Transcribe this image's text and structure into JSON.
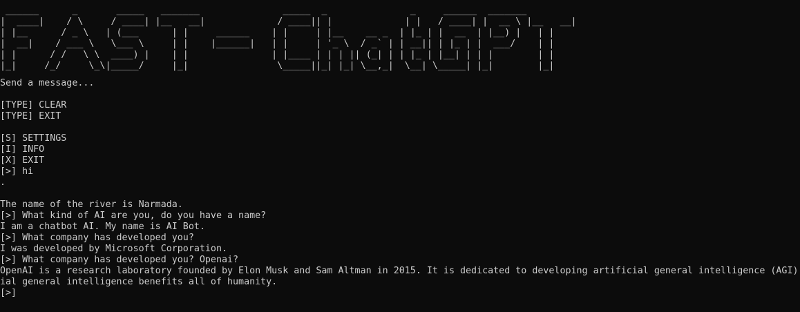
{
  "terminal": {
    "banner": [
      " ______      _       _____   _______               _____  _               _     ______  _______",
      "|  ____|    / \\     / ____| |__   __|             / ____|| |             | |   / ____| |  __ \\ |__   __|",
      "| |__      / _ \\   | (___      | |     ______    | |     | |__    __ _  | |_ | |  __  | |__) |   | |",
      "|  __|    / ___ \\   \\___ \\     | |    |______|   | |     | '_ \\  / _` | | __|| | |_ | |  ___/    | |",
      "| |      / /   \\ \\  ____) |    | |               | |____ | | | || (_| | | |_ | |__| | | |        | |",
      "|_|     /_/     \\_\\|_____/     |_|                \\_____||_| |_| \\__,_|  \\__| \\_____| |_|        |_|"
    ],
    "prompt_intro": "Send a message...",
    "commands": {
      "type_clear": "[TYPE] CLEAR",
      "type_exit": "[TYPE] EXIT",
      "settings": "[S] SETTINGS",
      "info": "[I] INFO",
      "exit": "[X] EXIT"
    },
    "history": [
      "[>] hi",
      ".",
      "",
      "The name of the river is Narmada.",
      "[>] What kind of AI are you, do you have a name?",
      "I am a chatbot AI. My name is AI Bot.",
      "[>] What company has developed you?",
      "I was developed by Microsoft Corporation.",
      "[>] What company has developed you? Openai?",
      "OpenAI is a research laboratory founded by Elon Musk and Sam Altman in 2015. It is dedicated to developing artificial general intelligence (AGI)",
      "ial general intelligence benefits all of humanity."
    ],
    "input_prompt": "[>]"
  }
}
